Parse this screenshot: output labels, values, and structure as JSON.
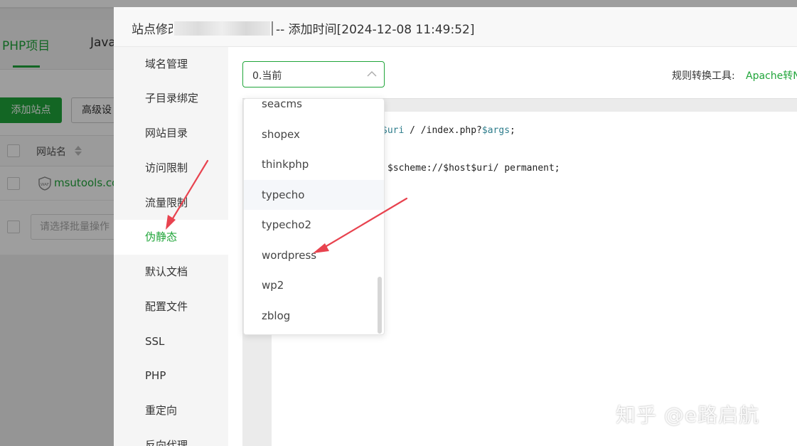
{
  "background": {
    "tabs": [
      {
        "label": "PHP项目",
        "active": true
      },
      {
        "label": "Java",
        "active": false
      }
    ],
    "add_site_button": "添加站点",
    "advanced_button": "高级设",
    "table": {
      "column_site_name": "网站名",
      "row_site": "msutools.co",
      "waf_badge": "WAF"
    },
    "batch_placeholder": "请选择批量操作"
  },
  "modal": {
    "title_prefix": "站点修改",
    "title_suffix": "-- 添加时间[2024-12-08 11:49:52]",
    "nav": [
      {
        "label": "域名管理",
        "active": false
      },
      {
        "label": "子目录绑定",
        "active": false
      },
      {
        "label": "网站目录",
        "active": false
      },
      {
        "label": "访问限制",
        "active": false
      },
      {
        "label": "流量限制",
        "active": false
      },
      {
        "label": "伪静态",
        "active": true
      },
      {
        "label": "默认文档",
        "active": false
      },
      {
        "label": "配置文件",
        "active": false
      },
      {
        "label": "SSL",
        "active": false
      },
      {
        "label": "PHP",
        "active": false
      },
      {
        "label": "重定向",
        "active": false
      },
      {
        "label": "反向代理",
        "active": false
      }
    ],
    "rewrite": {
      "select_value": "0.当前",
      "tool_label": "规则转换工具:",
      "tool_link": "Apache转N",
      "code": {
        "line1_var1": "$uri",
        "line1_text": "/ /index.php?",
        "line1_var2": "$args",
        "line1_end": ";",
        "line2": "$scheme://$host$uri/ permanent;"
      },
      "dropdown_options": [
        "seacms",
        "shopex",
        "thinkphp",
        "typecho",
        "typecho2",
        "wordpress",
        "wp2",
        "zblog"
      ],
      "hovered_option": "typecho"
    }
  },
  "watermark": "知乎 @e路启航",
  "colors": {
    "accent": "#20a53a",
    "annotation_arrow": "#e8434f"
  }
}
